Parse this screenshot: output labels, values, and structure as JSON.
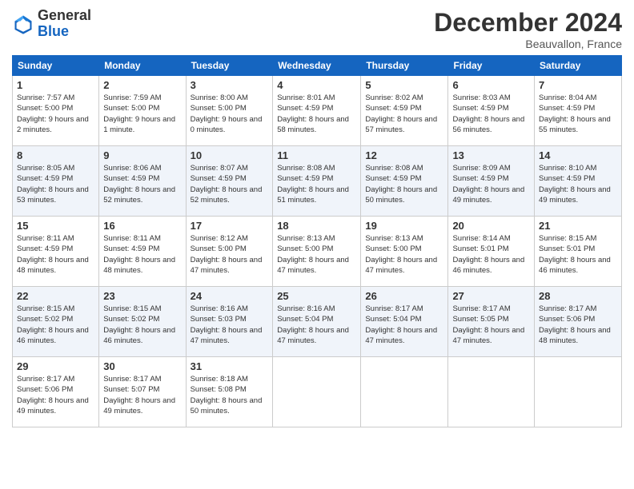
{
  "header": {
    "logo_line1": "General",
    "logo_line2": "Blue",
    "title": "December 2024",
    "location": "Beauvallon, France"
  },
  "weekdays": [
    "Sunday",
    "Monday",
    "Tuesday",
    "Wednesday",
    "Thursday",
    "Friday",
    "Saturday"
  ],
  "weeks": [
    [
      {
        "day": "1",
        "sunrise": "Sunrise: 7:57 AM",
        "sunset": "Sunset: 5:00 PM",
        "daylight": "Daylight: 9 hours and 2 minutes."
      },
      {
        "day": "2",
        "sunrise": "Sunrise: 7:59 AM",
        "sunset": "Sunset: 5:00 PM",
        "daylight": "Daylight: 9 hours and 1 minute."
      },
      {
        "day": "3",
        "sunrise": "Sunrise: 8:00 AM",
        "sunset": "Sunset: 5:00 PM",
        "daylight": "Daylight: 9 hours and 0 minutes."
      },
      {
        "day": "4",
        "sunrise": "Sunrise: 8:01 AM",
        "sunset": "Sunset: 4:59 PM",
        "daylight": "Daylight: 8 hours and 58 minutes."
      },
      {
        "day": "5",
        "sunrise": "Sunrise: 8:02 AM",
        "sunset": "Sunset: 4:59 PM",
        "daylight": "Daylight: 8 hours and 57 minutes."
      },
      {
        "day": "6",
        "sunrise": "Sunrise: 8:03 AM",
        "sunset": "Sunset: 4:59 PM",
        "daylight": "Daylight: 8 hours and 56 minutes."
      },
      {
        "day": "7",
        "sunrise": "Sunrise: 8:04 AM",
        "sunset": "Sunset: 4:59 PM",
        "daylight": "Daylight: 8 hours and 55 minutes."
      }
    ],
    [
      {
        "day": "8",
        "sunrise": "Sunrise: 8:05 AM",
        "sunset": "Sunset: 4:59 PM",
        "daylight": "Daylight: 8 hours and 53 minutes."
      },
      {
        "day": "9",
        "sunrise": "Sunrise: 8:06 AM",
        "sunset": "Sunset: 4:59 PM",
        "daylight": "Daylight: 8 hours and 52 minutes."
      },
      {
        "day": "10",
        "sunrise": "Sunrise: 8:07 AM",
        "sunset": "Sunset: 4:59 PM",
        "daylight": "Daylight: 8 hours and 52 minutes."
      },
      {
        "day": "11",
        "sunrise": "Sunrise: 8:08 AM",
        "sunset": "Sunset: 4:59 PM",
        "daylight": "Daylight: 8 hours and 51 minutes."
      },
      {
        "day": "12",
        "sunrise": "Sunrise: 8:08 AM",
        "sunset": "Sunset: 4:59 PM",
        "daylight": "Daylight: 8 hours and 50 minutes."
      },
      {
        "day": "13",
        "sunrise": "Sunrise: 8:09 AM",
        "sunset": "Sunset: 4:59 PM",
        "daylight": "Daylight: 8 hours and 49 minutes."
      },
      {
        "day": "14",
        "sunrise": "Sunrise: 8:10 AM",
        "sunset": "Sunset: 4:59 PM",
        "daylight": "Daylight: 8 hours and 49 minutes."
      }
    ],
    [
      {
        "day": "15",
        "sunrise": "Sunrise: 8:11 AM",
        "sunset": "Sunset: 4:59 PM",
        "daylight": "Daylight: 8 hours and 48 minutes."
      },
      {
        "day": "16",
        "sunrise": "Sunrise: 8:11 AM",
        "sunset": "Sunset: 4:59 PM",
        "daylight": "Daylight: 8 hours and 48 minutes."
      },
      {
        "day": "17",
        "sunrise": "Sunrise: 8:12 AM",
        "sunset": "Sunset: 5:00 PM",
        "daylight": "Daylight: 8 hours and 47 minutes."
      },
      {
        "day": "18",
        "sunrise": "Sunrise: 8:13 AM",
        "sunset": "Sunset: 5:00 PM",
        "daylight": "Daylight: 8 hours and 47 minutes."
      },
      {
        "day": "19",
        "sunrise": "Sunrise: 8:13 AM",
        "sunset": "Sunset: 5:00 PM",
        "daylight": "Daylight: 8 hours and 47 minutes."
      },
      {
        "day": "20",
        "sunrise": "Sunrise: 8:14 AM",
        "sunset": "Sunset: 5:01 PM",
        "daylight": "Daylight: 8 hours and 46 minutes."
      },
      {
        "day": "21",
        "sunrise": "Sunrise: 8:15 AM",
        "sunset": "Sunset: 5:01 PM",
        "daylight": "Daylight: 8 hours and 46 minutes."
      }
    ],
    [
      {
        "day": "22",
        "sunrise": "Sunrise: 8:15 AM",
        "sunset": "Sunset: 5:02 PM",
        "daylight": "Daylight: 8 hours and 46 minutes."
      },
      {
        "day": "23",
        "sunrise": "Sunrise: 8:15 AM",
        "sunset": "Sunset: 5:02 PM",
        "daylight": "Daylight: 8 hours and 46 minutes."
      },
      {
        "day": "24",
        "sunrise": "Sunrise: 8:16 AM",
        "sunset": "Sunset: 5:03 PM",
        "daylight": "Daylight: 8 hours and 47 minutes."
      },
      {
        "day": "25",
        "sunrise": "Sunrise: 8:16 AM",
        "sunset": "Sunset: 5:04 PM",
        "daylight": "Daylight: 8 hours and 47 minutes."
      },
      {
        "day": "26",
        "sunrise": "Sunrise: 8:17 AM",
        "sunset": "Sunset: 5:04 PM",
        "daylight": "Daylight: 8 hours and 47 minutes."
      },
      {
        "day": "27",
        "sunrise": "Sunrise: 8:17 AM",
        "sunset": "Sunset: 5:05 PM",
        "daylight": "Daylight: 8 hours and 47 minutes."
      },
      {
        "day": "28",
        "sunrise": "Sunrise: 8:17 AM",
        "sunset": "Sunset: 5:06 PM",
        "daylight": "Daylight: 8 hours and 48 minutes."
      }
    ],
    [
      {
        "day": "29",
        "sunrise": "Sunrise: 8:17 AM",
        "sunset": "Sunset: 5:06 PM",
        "daylight": "Daylight: 8 hours and 49 minutes."
      },
      {
        "day": "30",
        "sunrise": "Sunrise: 8:17 AM",
        "sunset": "Sunset: 5:07 PM",
        "daylight": "Daylight: 8 hours and 49 minutes."
      },
      {
        "day": "31",
        "sunrise": "Sunrise: 8:18 AM",
        "sunset": "Sunset: 5:08 PM",
        "daylight": "Daylight: 8 hours and 50 minutes."
      },
      null,
      null,
      null,
      null
    ]
  ]
}
